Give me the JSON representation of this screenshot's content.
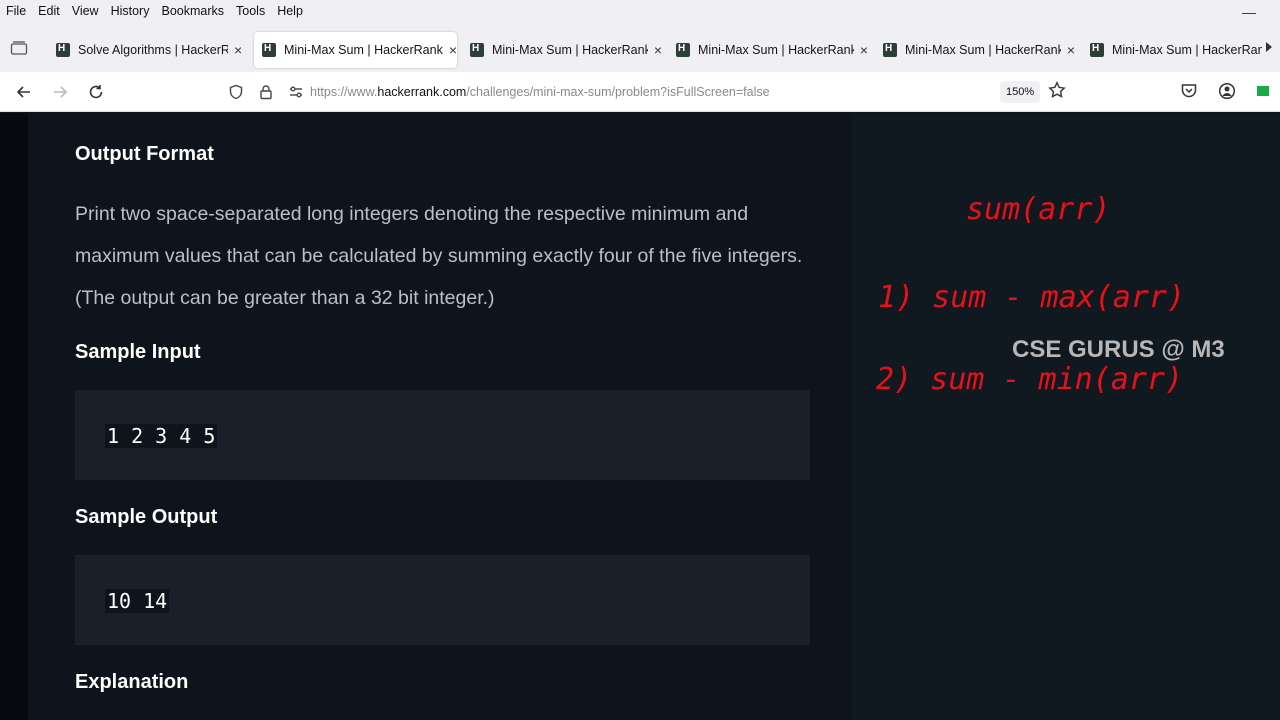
{
  "menubar": {
    "items": [
      "File",
      "Edit",
      "View",
      "History",
      "Bookmarks",
      "Tools",
      "Help"
    ]
  },
  "tabs": [
    {
      "title": "Solve Algorithms | HackerRa",
      "active": false
    },
    {
      "title": "Mini-Max Sum | HackerRank",
      "active": true
    },
    {
      "title": "Mini-Max Sum | HackerRank",
      "active": false
    },
    {
      "title": "Mini-Max Sum | HackerRank",
      "active": false
    },
    {
      "title": "Mini-Max Sum | HackerRank",
      "active": false
    },
    {
      "title": "Mini-Max Sum | HackerRank",
      "active": false
    }
  ],
  "tab_close_glyph": "×",
  "navbar": {
    "url_prefix": "https://www.",
    "url_host": "hackerrank.com",
    "url_path": "/challenges/mini-max-sum/problem?isFullScreen=false",
    "zoom": "150%"
  },
  "problem": {
    "output_format_heading": "Output Format",
    "output_format_text": "Print two space-separated long integers denoting the respective minimum and maximum values that can be calculated by summing exactly four of the five integers. (The output can be greater than a 32 bit integer.)",
    "sample_input_heading": "Sample Input",
    "sample_input": "1 2 3 4 5",
    "sample_output_heading": "Sample Output",
    "sample_output": "10 14",
    "explanation_heading": "Explanation"
  },
  "annotations": {
    "line1": "sum(arr)",
    "line2": "1) sum - max(arr)",
    "line3": "2) sum - min(arr)",
    "ink_color": "#e8101a"
  },
  "watermark": "CSE GURUS @ M3",
  "colors": {
    "page_bg": "#0e141b",
    "code_bg": "#1a2029",
    "hackerrank_green": "#1ba94c"
  }
}
